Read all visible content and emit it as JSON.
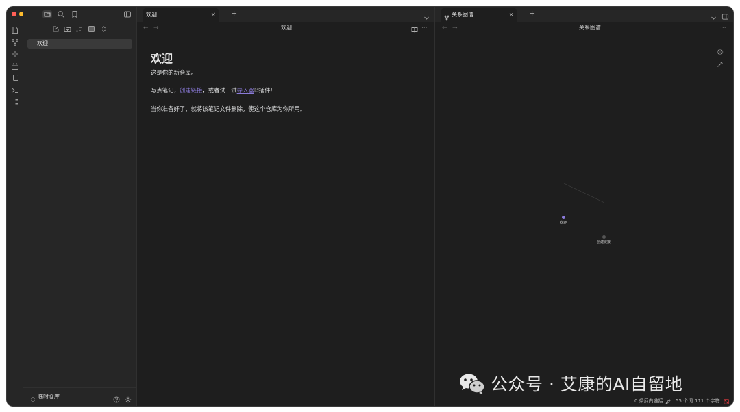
{
  "ribbon": {
    "icons": [
      "open-note-icon",
      "graph-view-icon",
      "canvas-icon",
      "daily-note-icon",
      "templates-icon",
      "command-palette-icon",
      "bases-icon"
    ]
  },
  "sidebar": {
    "file_item": "欢迎",
    "vault_name": "临时仓库"
  },
  "left_pane": {
    "tab_label": "欢迎",
    "tab_close": "×",
    "new_tab": "+",
    "nav_title": "欢迎",
    "doc": {
      "title": "欢迎",
      "p1": "这是你的新仓库。",
      "p2_before": "写点笔记，",
      "p2_link": "创建链接",
      "p2_mid": "，或者试一试",
      "p2_ext_link": "导入器",
      "p2_after": "插件!",
      "p3": "当你准备好了，就将该笔记文件删除，使这个仓库为你所用。"
    }
  },
  "right_pane": {
    "tab_label": "关系图谱",
    "tab_close": "×",
    "new_tab": "+",
    "nav_title": "关系图谱",
    "graph": {
      "nodes": [
        {
          "label": "欢迎",
          "color": "#8a7ad8"
        },
        {
          "label": "创建链接",
          "color": "#555555"
        }
      ]
    }
  },
  "statusbar": {
    "backlinks": "0 条反向链接",
    "words": "55 个词",
    "chars": "111 个字符"
  },
  "watermark": {
    "text": "公众号 · 艾康的AI自留地"
  },
  "colors": {
    "accent": "#8a7ad8",
    "background": "#1e1e1e",
    "sidebar": "#262626",
    "sync_error": "#e0393e"
  }
}
